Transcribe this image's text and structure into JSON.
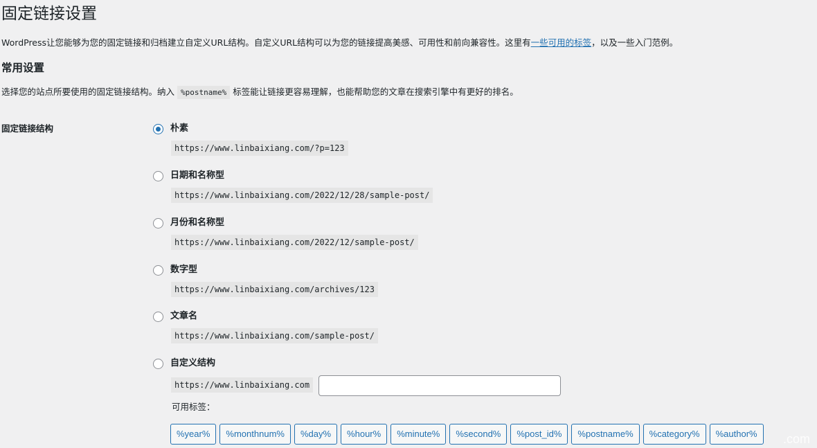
{
  "page": {
    "title": "固定链接设置",
    "intro_before": "WordPress让您能够为您的固定链接和归档建立自定义URL结构。自定义URL结构可以为您的链接提高美感、可用性和前向兼容性。这里有",
    "intro_link": "一些可用的标签",
    "intro_after": "，以及一些入门范例。"
  },
  "common": {
    "heading": "常用设置",
    "desc_before": "选择您的站点所要使用的固定链接结构。纳入",
    "desc_code": "%postname%",
    "desc_after": "标签能让链接更容易理解，也能帮助您的文章在搜索引擎中有更好的排名。"
  },
  "structure": {
    "label": "固定链接结构",
    "selected": "plain",
    "options": [
      {
        "id": "plain",
        "label": "朴素",
        "example": "https://www.linbaixiang.com/?p=123"
      },
      {
        "id": "day-name",
        "label": "日期和名称型",
        "example": "https://www.linbaixiang.com/2022/12/28/sample-post/"
      },
      {
        "id": "month-name",
        "label": "月份和名称型",
        "example": "https://www.linbaixiang.com/2022/12/sample-post/"
      },
      {
        "id": "numeric",
        "label": "数字型",
        "example": "https://www.linbaixiang.com/archives/123"
      },
      {
        "id": "post-name",
        "label": "文章名",
        "example": "https://www.linbaixiang.com/sample-post/"
      },
      {
        "id": "custom",
        "label": "自定义结构",
        "example": ""
      }
    ],
    "custom_base": "https://www.linbaixiang.com",
    "custom_value": "",
    "tags_label": "可用标签：",
    "tags": [
      "%year%",
      "%monthnum%",
      "%day%",
      "%hour%",
      "%minute%",
      "%second%",
      "%post_id%",
      "%postname%",
      "%category%",
      "%author%"
    ]
  },
  "watermark": ".com"
}
